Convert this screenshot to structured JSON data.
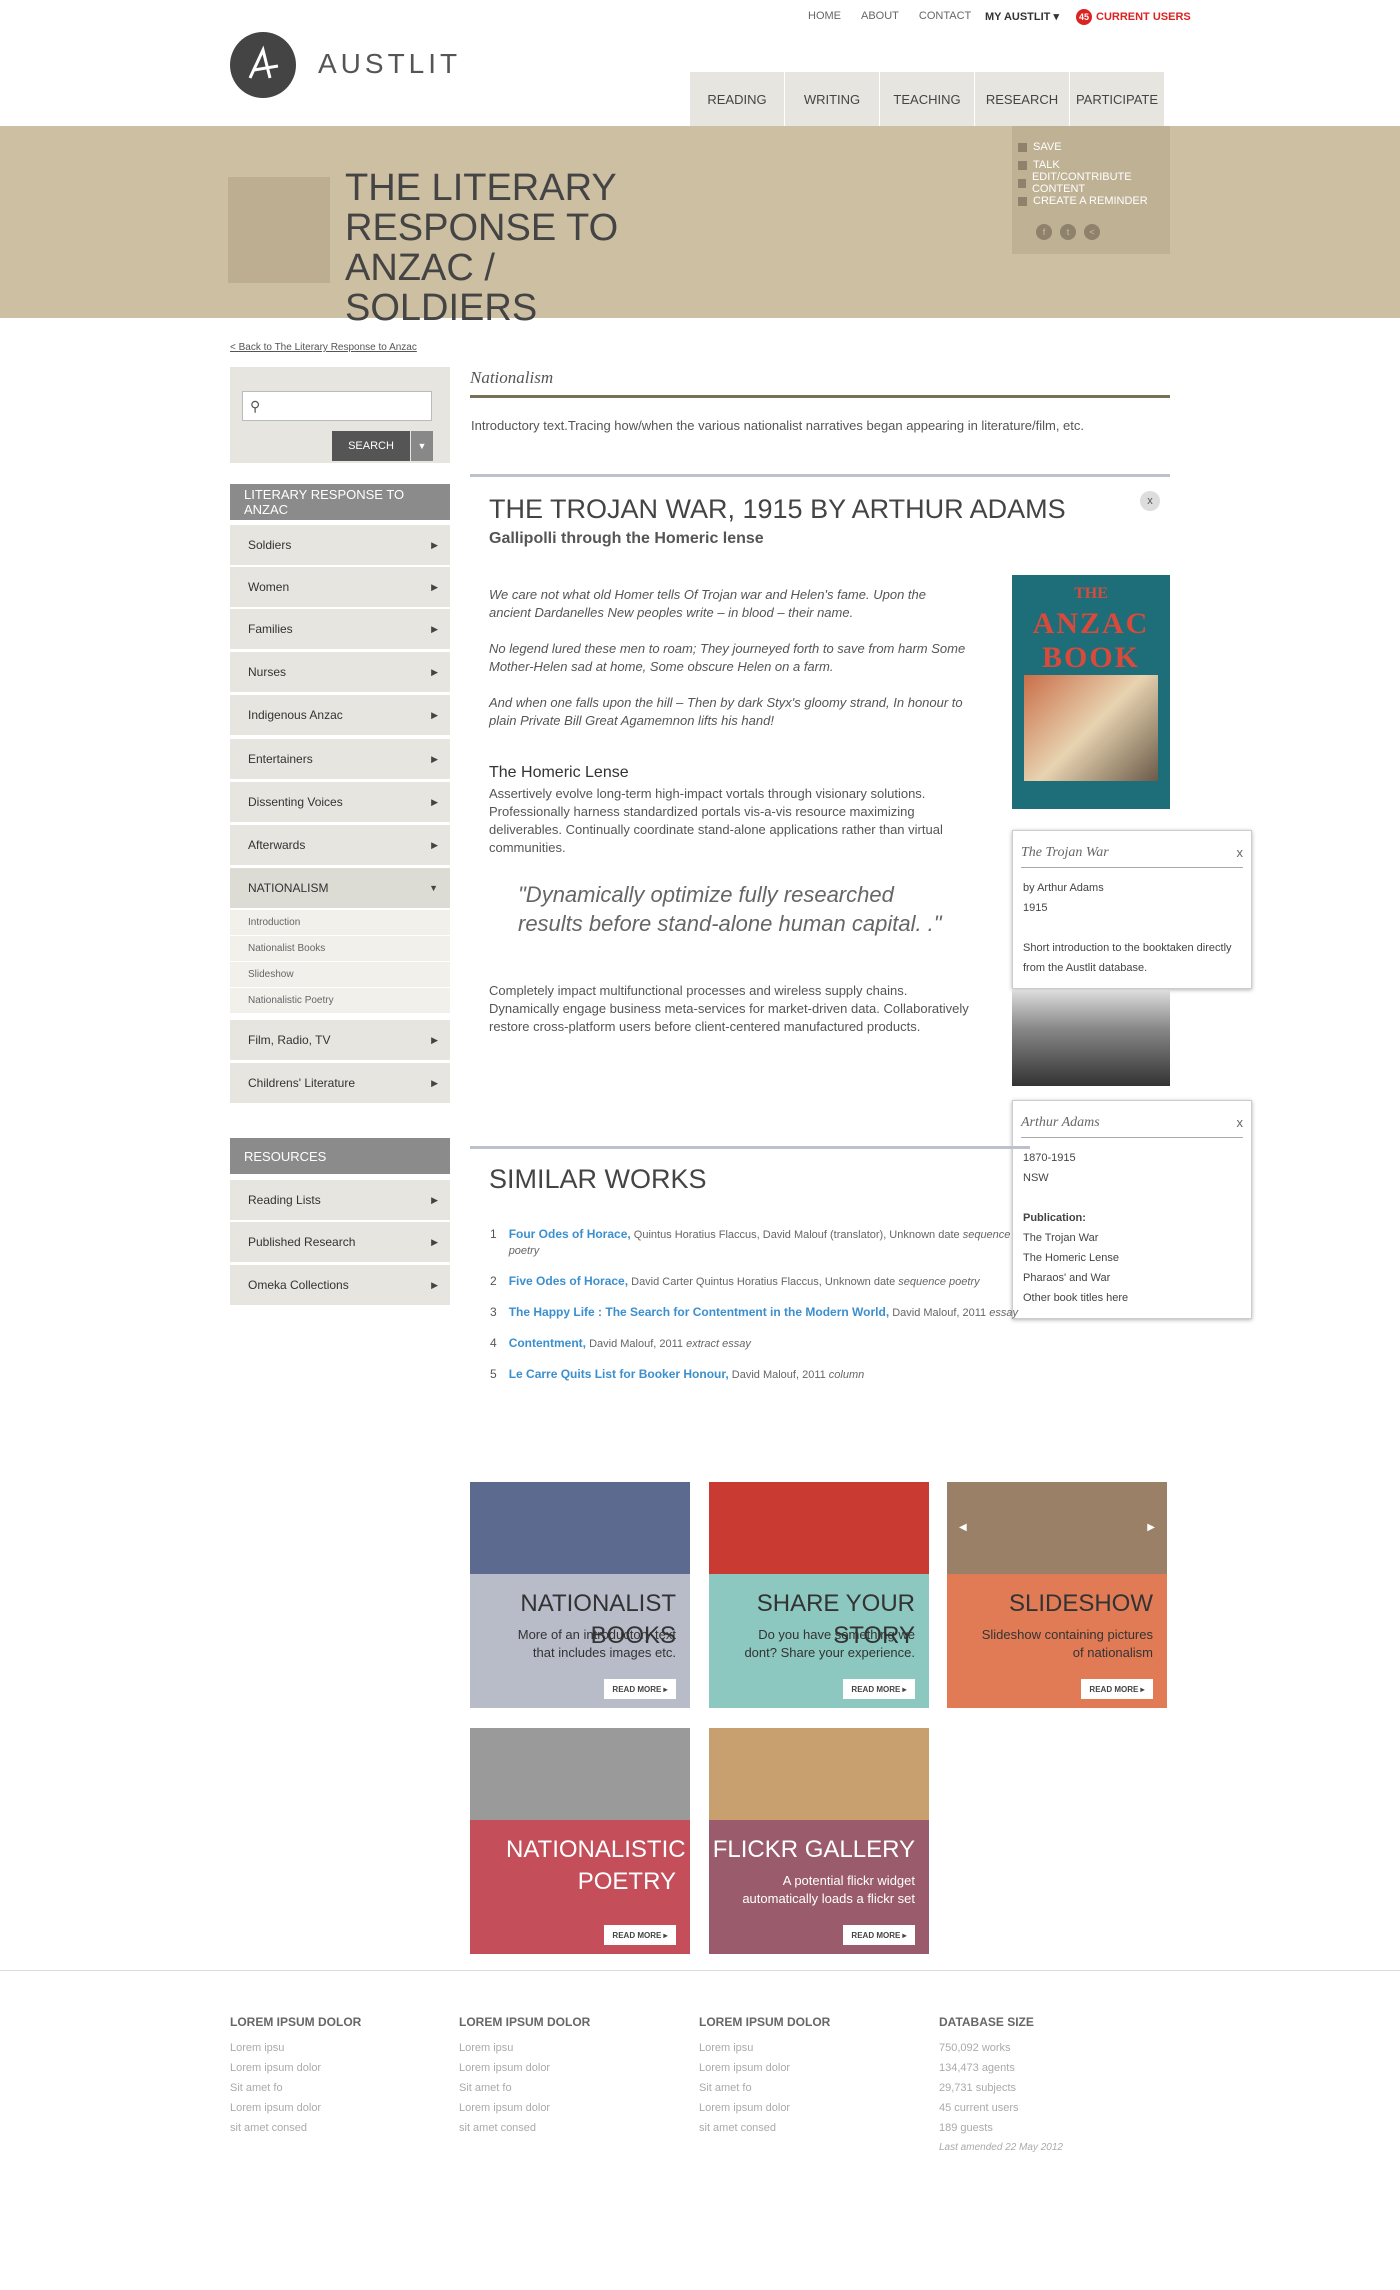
{
  "topnav": [
    "HOME",
    "ABOUT",
    "CONTACT"
  ],
  "my_austlit": "MY AUSTLIT ▾",
  "current_users": {
    "count": "45",
    "label": "CURRENT USERS"
  },
  "logo": {
    "text": "AUSTLIT"
  },
  "mainnav": [
    "READING",
    "WRITING",
    "TEACHING",
    "RESEARCH",
    "PARTICIPATE"
  ],
  "banner": {
    "title": "THE LITERARY RESPONSE TO ANZAC / SOLDIERS"
  },
  "actions": [
    "SAVE",
    "TALK",
    "EDIT/CONTRIBUTE CONTENT",
    "CREATE A REMINDER"
  ],
  "back_link": "< Back to The Literary Response to Anzac",
  "search": {
    "placeholder": "",
    "button": "SEARCH"
  },
  "sidebar": {
    "heading": "LITERARY RESPONSE TO ANZAC",
    "items_top": [
      "Soldiers",
      "Women",
      "Families",
      "Nurses",
      "Indigenous Anzac",
      "Entertainers",
      "Dissenting Voices",
      "Afterwards"
    ],
    "active": "NATIONALISM",
    "subitems": [
      "Introduction",
      "Nationalist Books",
      "Slideshow",
      "Nationalistic Poetry"
    ],
    "items_bottom": [
      "Film, Radio, TV",
      "Childrens' Literature"
    ],
    "resources_heading": "RESOURCES",
    "resources": [
      "Reading Lists",
      "Published Research",
      "Omeka Collections"
    ]
  },
  "main": {
    "section": "Nationalism",
    "intro": "Introductory text.Tracing how/when the various nationalist narratives began appearing in literature/film, etc.",
    "title": "THE TROJAN WAR, 1915 BY ARTHUR ADAMS",
    "subtitle": "Gallipolli through the Homeric lense",
    "poem": [
      "We care not what old Homer tells Of Trojan war and Helen's fame. Upon the ancient Dardanelles New peoples write – in blood – their name.",
      "No legend lured these men to roam; They journeyed forth to save from harm Some Mother-Helen sad at home, Some obscure Helen on a farm.",
      "And when one falls upon the hill – Then by dark Styx's gloomy strand, In honour to plain Private Bill Great Agamemnon lifts his hand!"
    ],
    "subheading": "The Homeric Lense",
    "para1": "Assertively evolve long-term high-impact vortals through visionary solutions. Professionally harness standardized portals vis-a-vis resource maximizing deliverables. Continually coordinate stand-alone applications rather than virtual communities.",
    "quote": "\"Dynamically optimize fully researched results before stand-alone human capital. .\"",
    "para2": "Completely impact multifunctional processes and wireless supply chains. Dynamically engage business meta-services for market-driven data. Collaboratively restore cross-platform users before client-centered manufactured products."
  },
  "book": {
    "line1": "THE",
    "line2": "ANZAC BOOK"
  },
  "popup_book": {
    "title": "The Trojan War",
    "close": "x",
    "lines": [
      "by Arthur Adams",
      "1915",
      "",
      "Short introduction to the booktaken directly from the Austlit database."
    ]
  },
  "popup_author": {
    "title": "Arthur Adams",
    "close": "x",
    "lines": [
      "1870-1915",
      "NSW",
      "",
      "Publication:",
      "The Trojan War",
      "The Homeric Lense",
      "Pharaos' and War",
      "Other book titles here"
    ]
  },
  "similar": {
    "title": "SIMILAR WORKS",
    "items": [
      {
        "n": "1",
        "title": "Four Odes of Horace,",
        "meta": " Quintus Horatius Flaccus, David Malouf (translator), Unknown date ",
        "genre": "sequence poetry"
      },
      {
        "n": "2",
        "title": "Five Odes of Horace,",
        "meta": " David Carter Quintus Horatius Flaccus, Unknown date ",
        "genre": "sequence poetry"
      },
      {
        "n": "3",
        "title": "The Happy Life : The Search for Contentment in the Modern World,",
        "meta": " David Malouf, 2011 ",
        "genre": "essay"
      },
      {
        "n": "4",
        "title": "Contentment,",
        "meta": " David Malouf, 2011 ",
        "genre": "extract essay"
      },
      {
        "n": "5",
        "title": "Le Carre Quits List for Booker Honour,",
        "meta": " David Malouf, 2011 ",
        "genre": "column"
      }
    ]
  },
  "tiles": [
    {
      "title": "NATIONALIST BOOKS",
      "desc": "More of an introductory text that includes images etc.",
      "rm": "READ MORE ▸",
      "color": "#b7bcc8",
      "img": "#5b6a8e"
    },
    {
      "title": "SHARE YOUR STORY",
      "desc": "Do you have something we dont? Share your experience.",
      "rm": "READ MORE ▸",
      "color": "#8cc8bf",
      "img": "#c93a33"
    },
    {
      "title": "SLIDESHOW",
      "desc": "Slideshow containing pictures of nationalism",
      "rm": "READ MORE ▸",
      "color": "#e07b56",
      "img": "#9a8066"
    },
    {
      "title": "NATIONALISTIC POETRY",
      "desc": "",
      "rm": "READ MORE ▸",
      "color": "#c44f5a",
      "img": "#9a9a9a"
    },
    {
      "title": "FLICKR GALLERY",
      "desc": "A potential flickr widget automatically loads a flickr set",
      "rm": "READ MORE ▸",
      "color": "#9a5c6c",
      "img": "#c8a070"
    }
  ],
  "footer": {
    "cols": [
      {
        "heading": "LOREM IPSUM DOLOR",
        "lines": [
          "Lorem ipsu",
          "Lorem ipsum dolor",
          "Sit amet fo",
          "Lorem ipsum dolor",
          "sit amet consed"
        ]
      },
      {
        "heading": "LOREM IPSUM DOLOR",
        "lines": [
          "Lorem ipsu",
          "Lorem ipsum dolor",
          "Sit amet fo",
          "Lorem ipsum dolor",
          "sit amet consed"
        ]
      },
      {
        "heading": "LOREM IPSUM DOLOR",
        "lines": [
          "Lorem ipsu",
          "Lorem ipsum dolor",
          "Sit amet fo",
          "Lorem ipsum dolor",
          "sit amet consed"
        ]
      },
      {
        "heading": "DATABASE SIZE",
        "lines": [
          "750,092 works",
          "134,473 agents",
          "29,731 subjects",
          "45 current users",
          "189 guests"
        ]
      }
    ],
    "amended": "Last amended 22 May 2012"
  }
}
